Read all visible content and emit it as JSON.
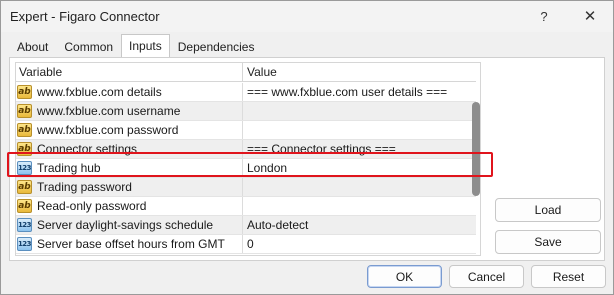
{
  "window": {
    "title": "Expert - Figaro Connector",
    "help_label": "?",
    "close_label": "✕"
  },
  "tabs": [
    {
      "label": "About",
      "active": false
    },
    {
      "label": "Common",
      "active": false
    },
    {
      "label": "Inputs",
      "active": true
    },
    {
      "label": "Dependencies",
      "active": false
    }
  ],
  "grid": {
    "columns": {
      "variable": "Variable",
      "value": "Value"
    },
    "rows": [
      {
        "icon": "ab",
        "icon_name": "string-type-icon",
        "variable": "www.fxblue.com details",
        "value": "=== www.fxblue.com user details ==="
      },
      {
        "icon": "ab",
        "icon_name": "string-type-icon",
        "variable": "www.fxblue.com username",
        "value": ""
      },
      {
        "icon": "ab",
        "icon_name": "string-type-icon",
        "variable": "www.fxblue.com password",
        "value": ""
      },
      {
        "icon": "ab",
        "icon_name": "string-type-icon",
        "variable": "Connector settings",
        "value": "=== Connector settings ==="
      },
      {
        "icon": "123",
        "icon_name": "numeric-type-icon",
        "variable": "Trading hub",
        "value": "London",
        "highlighted": true
      },
      {
        "icon": "ab",
        "icon_name": "string-type-icon",
        "variable": "Trading password",
        "value": ""
      },
      {
        "icon": "ab",
        "icon_name": "string-type-icon",
        "variable": "Read-only password",
        "value": ""
      },
      {
        "icon": "123",
        "icon_name": "numeric-type-icon",
        "variable": "Server daylight-savings schedule",
        "value": "Auto-detect"
      },
      {
        "icon": "123",
        "icon_name": "numeric-type-icon",
        "variable": "Server base offset hours from GMT",
        "value": "0"
      }
    ]
  },
  "buttons": {
    "load": "Load",
    "save": "Save",
    "ok": "OK",
    "cancel": "Cancel",
    "reset": "Reset"
  },
  "colors": {
    "highlight_border": "#e0141c",
    "ok_border": "#7a9bd0"
  }
}
